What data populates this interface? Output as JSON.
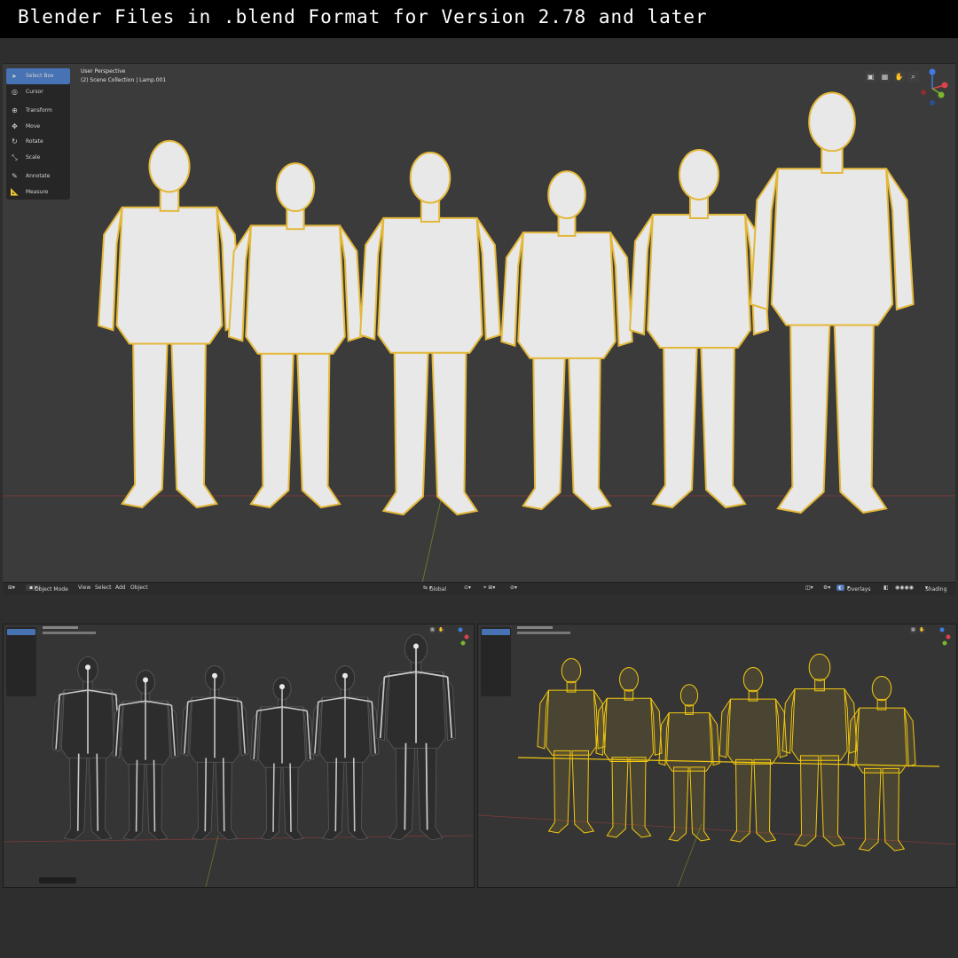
{
  "banner": {
    "title": "Blender Files in .blend Format for Version 2.78 and later"
  },
  "main_viewport": {
    "overlay_line1": "User Perspective",
    "overlay_line2": "(2) Scene Collection | Lamp.001",
    "toolbar": [
      {
        "label": "Select Box",
        "icon": "select-box-icon",
        "active": true
      },
      {
        "label": "Cursor",
        "icon": "cursor-icon"
      },
      {
        "label": "Transform",
        "icon": "transform-icon"
      },
      {
        "label": "Move",
        "icon": "move-icon"
      },
      {
        "label": "Rotate",
        "icon": "rotate-icon"
      },
      {
        "label": "Scale",
        "icon": "scale-icon"
      },
      {
        "label": "Annotate",
        "icon": "annotate-icon"
      },
      {
        "label": "Measure",
        "icon": "measure-icon"
      }
    ],
    "header": {
      "mode": "Object Mode",
      "menus": [
        "View",
        "Select",
        "Add",
        "Object"
      ],
      "orientation": "Global",
      "overlays_label": "Overlays",
      "shading_label": "Shading"
    }
  },
  "colors": {
    "background": "#2e2e2e",
    "viewport_bg": "#3b3b3b",
    "toolbar_bg": "#262626",
    "active_tool": "#4772b3",
    "mesh_fill": "#e8e8e8",
    "selection_outline": "#e3b83a",
    "wireframe_yellow": "#f2c80f",
    "axis_x_red": "#d8444a",
    "axis_y_green": "#7ab72e",
    "axis_z_blue": "#3f7be2"
  },
  "bottom_left_viewport": {
    "description_mode": "wireframe-armature"
  },
  "bottom_right_viewport": {
    "description_mode": "wireframe-selected"
  }
}
